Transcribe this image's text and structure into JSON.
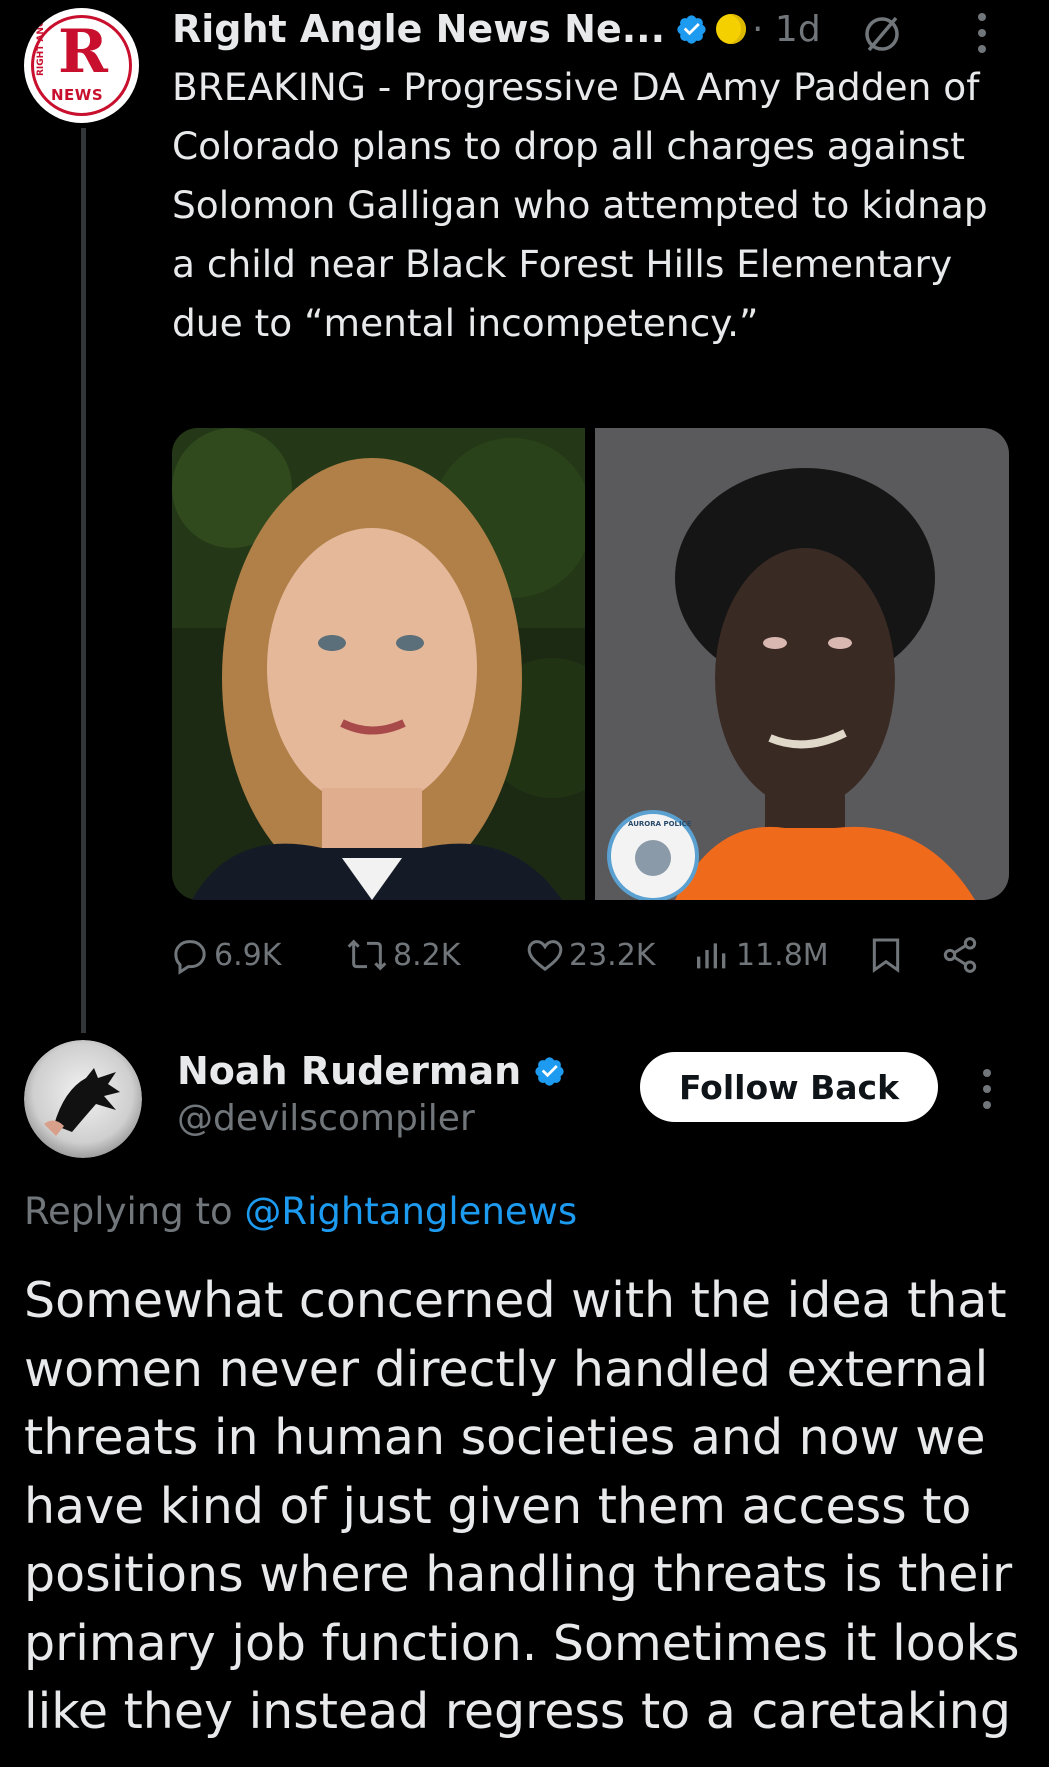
{
  "post": {
    "author_name": "Right Angle News Ne...",
    "time": "· 1d",
    "avatar_text": {
      "letter": "R",
      "word": "NEWS",
      "vertical": "RIGHT ANGLE"
    },
    "text": "BREAKING - Progressive DA Amy Padden of Colorado plans to drop all charges against Solomon Galligan who attempted to kidnap a child near Black Forest Hills Elementary due to “mental incompetency.”",
    "mugshot_seal_text": "AURORA POLICE",
    "actions": {
      "replies": "6.9K",
      "reposts": "8.2K",
      "likes": "23.2K",
      "views": "11.8M"
    }
  },
  "reply": {
    "author_name": "Noah Ruderman",
    "handle": "@devilscompiler",
    "follow_label": "Follow Back",
    "replying_prefix": "Replying to ",
    "replying_to": "@Rightanglenews",
    "text": "Somewhat concerned with the idea that women never directly handled external threats in human societies and now we have kind of just given them access to positions where handling threats is their primary job function. Sometimes it looks like they instead regress to a caretaking"
  },
  "colors": {
    "background": "#000000",
    "text": "#e7e9ea",
    "muted": "#71767b",
    "accent": "#1d9bf0",
    "brand_red": "#c8102e"
  },
  "icons": [
    "verified-badge-icon",
    "gold-badge-icon",
    "mute-icon",
    "more-icon",
    "reply-icon",
    "repost-icon",
    "like-icon",
    "views-icon",
    "bookmark-icon",
    "share-icon"
  ]
}
